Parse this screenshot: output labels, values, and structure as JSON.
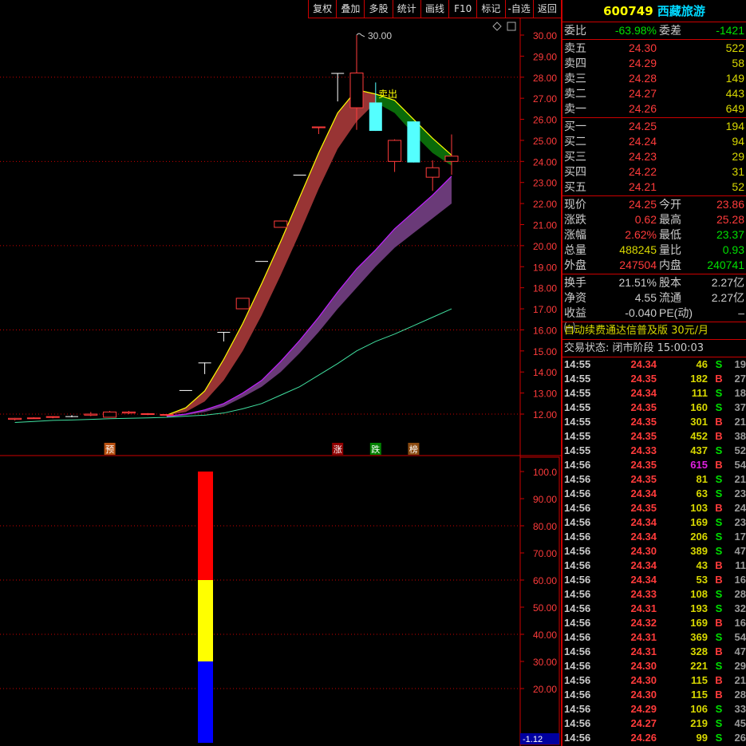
{
  "toolbar": [
    "复权",
    "叠加",
    "多股",
    "统计",
    "画线",
    "F10",
    "标记",
    "-自选",
    "返回"
  ],
  "stock": {
    "code": "600749",
    "name": "西藏旅游"
  },
  "weibi": {
    "label": "委比",
    "value": "-63.98%",
    "label2": "委差",
    "value2": "-1421"
  },
  "sell": [
    {
      "label": "卖五",
      "price": "24.30",
      "vol": "522"
    },
    {
      "label": "卖四",
      "price": "24.29",
      "vol": "58"
    },
    {
      "label": "卖三",
      "price": "24.28",
      "vol": "149"
    },
    {
      "label": "卖二",
      "price": "24.27",
      "vol": "443"
    },
    {
      "label": "卖一",
      "price": "24.26",
      "vol": "649"
    }
  ],
  "buy": [
    {
      "label": "买一",
      "price": "24.25",
      "vol": "194"
    },
    {
      "label": "买二",
      "price": "24.24",
      "vol": "94"
    },
    {
      "label": "买三",
      "price": "24.23",
      "vol": "29"
    },
    {
      "label": "买四",
      "price": "24.22",
      "vol": "31"
    },
    {
      "label": "买五",
      "price": "24.21",
      "vol": "52"
    }
  ],
  "stats": [
    {
      "l": "现价",
      "v": "24.25",
      "vc": "red",
      "l2": "今开",
      "v2": "23.86",
      "v2c": "red"
    },
    {
      "l": "涨跌",
      "v": "0.62",
      "vc": "red",
      "l2": "最高",
      "v2": "25.28",
      "v2c": "red"
    },
    {
      "l": "涨幅",
      "v": "2.62%",
      "vc": "red",
      "l2": "最低",
      "v2": "23.37",
      "v2c": "grn"
    },
    {
      "l": "总量",
      "v": "488245",
      "vc": "yel",
      "l2": "量比",
      "v2": "0.93",
      "v2c": "grn"
    },
    {
      "l": "外盘",
      "v": "247504",
      "vc": "red",
      "l2": "内盘",
      "v2": "240741",
      "v2c": "grn"
    }
  ],
  "stats2": [
    {
      "l": "换手",
      "v": "21.51%",
      "l2": "股本",
      "v2": "2.27亿"
    },
    {
      "l": "净资",
      "v": "4.55",
      "l2": "流通",
      "v2": "2.27亿"
    },
    {
      "l": "收益㈠",
      "v": "-0.040",
      "l2": "PE(动)",
      "v2": "–"
    }
  ],
  "promo": "自动续费通达信普及版  30元/月",
  "status": "交易状态: 闭市阶段 15:00:03",
  "trades": [
    [
      "14:55",
      "24.34",
      "46",
      "S",
      "19"
    ],
    [
      "14:55",
      "24.35",
      "182",
      "B",
      "27"
    ],
    [
      "14:55",
      "24.34",
      "111",
      "S",
      "18"
    ],
    [
      "14:55",
      "24.35",
      "160",
      "S",
      "37"
    ],
    [
      "14:55",
      "24.35",
      "301",
      "B",
      "21"
    ],
    [
      "14:55",
      "24.35",
      "452",
      "B",
      "38"
    ],
    [
      "14:55",
      "24.33",
      "437",
      "S",
      "52"
    ],
    [
      "14:56",
      "24.35",
      "615",
      "B",
      "54"
    ],
    [
      "14:56",
      "24.35",
      "81",
      "S",
      "21"
    ],
    [
      "14:56",
      "24.34",
      "63",
      "S",
      "23"
    ],
    [
      "14:56",
      "24.35",
      "103",
      "B",
      "24"
    ],
    [
      "14:56",
      "24.34",
      "169",
      "S",
      "23"
    ],
    [
      "14:56",
      "24.34",
      "206",
      "S",
      "17"
    ],
    [
      "14:56",
      "24.30",
      "389",
      "S",
      "47"
    ],
    [
      "14:56",
      "24.34",
      "43",
      "B",
      "11"
    ],
    [
      "14:56",
      "24.34",
      "53",
      "B",
      "16"
    ],
    [
      "14:56",
      "24.33",
      "108",
      "S",
      "28"
    ],
    [
      "14:56",
      "24.31",
      "193",
      "S",
      "32"
    ],
    [
      "14:56",
      "24.32",
      "169",
      "B",
      "16"
    ],
    [
      "14:56",
      "24.31",
      "369",
      "S",
      "54"
    ],
    [
      "14:56",
      "24.31",
      "328",
      "B",
      "47"
    ],
    [
      "14:56",
      "24.30",
      "221",
      "S",
      "29"
    ],
    [
      "14:56",
      "24.30",
      "115",
      "B",
      "21"
    ],
    [
      "14:56",
      "24.30",
      "115",
      "B",
      "28"
    ],
    [
      "14:56",
      "24.29",
      "106",
      "S",
      "33"
    ],
    [
      "14:56",
      "24.27",
      "219",
      "S",
      "45"
    ],
    [
      "14:56",
      "24.26",
      "99",
      "S",
      "26"
    ]
  ],
  "chart_data": {
    "type": "candlestick",
    "price_axis": {
      "min": 12,
      "max": 30,
      "ticks": [
        "30.00",
        "29.00",
        "28.00",
        "27.00",
        "26.00",
        "25.00",
        "24.00",
        "23.00",
        "22.00",
        "21.00",
        "20.00",
        "19.00",
        "18.00",
        "17.00",
        "16.00",
        "15.00",
        "14.00",
        "13.00",
        "12.00"
      ]
    },
    "high_label": "30.00",
    "signal_label": "卖出",
    "markers": [
      {
        "i": 5,
        "text": "预",
        "color": "#b85010"
      },
      {
        "i": 17,
        "text": "涨",
        "color": "#900000"
      },
      {
        "i": 19,
        "text": "跌",
        "color": "#008000"
      },
      {
        "i": 21,
        "text": "榜",
        "color": "#8a4a10"
      }
    ],
    "candles": [
      [
        11.75,
        11.82,
        11.7,
        11.8
      ],
      [
        11.8,
        11.85,
        11.78,
        11.82
      ],
      [
        11.85,
        11.9,
        11.8,
        11.88
      ],
      [
        11.9,
        11.95,
        11.85,
        11.9
      ],
      [
        11.95,
        12.1,
        11.9,
        12.0
      ],
      [
        11.85,
        12.15,
        11.85,
        12.1
      ],
      [
        12.05,
        12.15,
        12.0,
        12.1
      ],
      [
        12.0,
        12.05,
        11.95,
        12.02
      ],
      [
        11.95,
        12.0,
        11.9,
        11.98
      ],
      [
        13.14,
        13.14,
        13.14,
        13.14
      ],
      [
        14.45,
        14.45,
        13.9,
        14.45
      ],
      [
        15.9,
        15.9,
        15.45,
        15.9
      ],
      [
        17.0,
        17.5,
        17.0,
        17.5
      ],
      [
        19.27,
        19.27,
        19.27,
        19.27
      ],
      [
        20.87,
        21.17,
        20.87,
        21.17
      ],
      [
        23.37,
        23.37,
        23.37,
        23.37
      ],
      [
        25.6,
        25.64,
        25.3,
        25.64
      ],
      [
        28.2,
        28.2,
        26.85,
        28.2
      ],
      [
        26.55,
        30.0,
        25.5,
        28.2
      ],
      [
        26.8,
        27.75,
        25.45,
        25.45
      ],
      [
        24.0,
        25.05,
        23.5,
        25.0
      ],
      [
        25.9,
        25.9,
        23.95,
        23.95
      ],
      [
        23.25,
        24.05,
        22.6,
        23.7
      ],
      [
        24.0,
        25.28,
        23.37,
        24.25
      ]
    ],
    "band1": [
      [
        8,
        11.95,
        11.95
      ],
      [
        9,
        12.3,
        12.1
      ],
      [
        10,
        13.1,
        12.6
      ],
      [
        11,
        14.6,
        13.6
      ],
      [
        12,
        16.3,
        15.0
      ],
      [
        13,
        18.2,
        16.7
      ],
      [
        14,
        20.2,
        18.6
      ],
      [
        15,
        22.3,
        20.6
      ],
      [
        16,
        24.4,
        22.7
      ],
      [
        17,
        26.3,
        24.6
      ],
      [
        18,
        27.4,
        25.9
      ],
      [
        19,
        27.2,
        26.8
      ]
    ],
    "band2": [
      [
        19,
        27.2,
        26.8
      ],
      [
        20,
        26.9,
        26.3
      ],
      [
        21,
        26.0,
        25.3
      ],
      [
        22,
        25.1,
        24.4
      ],
      [
        23,
        24.3,
        23.8
      ]
    ],
    "band_purple": [
      [
        8,
        11.9,
        11.85
      ],
      [
        9,
        12.0,
        11.95
      ],
      [
        10,
        12.2,
        12.1
      ],
      [
        11,
        12.5,
        12.35
      ],
      [
        12,
        13.0,
        12.8
      ],
      [
        13,
        13.6,
        13.3
      ],
      [
        14,
        14.5,
        14.0
      ],
      [
        15,
        15.5,
        14.9
      ],
      [
        16,
        16.6,
        15.9
      ],
      [
        17,
        17.8,
        17.0
      ],
      [
        18,
        18.9,
        18.0
      ],
      [
        19,
        19.8,
        19.0
      ],
      [
        20,
        20.8,
        19.9
      ],
      [
        21,
        21.6,
        20.6
      ],
      [
        22,
        22.4,
        21.3
      ],
      [
        23,
        23.3,
        22.0
      ]
    ],
    "ma_line": [
      11.6,
      11.65,
      11.7,
      11.72,
      11.75,
      11.78,
      11.8,
      11.82,
      11.85,
      11.9,
      11.95,
      12.05,
      12.25,
      12.5,
      12.9,
      13.3,
      13.85,
      14.4,
      15.0,
      15.45,
      15.8,
      16.2,
      16.6,
      17.0
    ],
    "indicator": {
      "axis": {
        "min": 0,
        "max": 100,
        "ticks": [
          "100.0",
          "90.00",
          "80.00",
          "70.00",
          "60.00",
          "50.00",
          "40.00",
          "30.00",
          "20.00"
        ]
      },
      "segments": [
        {
          "from": 60,
          "to": 100,
          "color": "#ff0000"
        },
        {
          "from": 30,
          "to": 60,
          "color": "#ffff00"
        },
        {
          "from": 0,
          "to": 30,
          "color": "#0000ff"
        }
      ],
      "value_label": "-1.12"
    }
  }
}
